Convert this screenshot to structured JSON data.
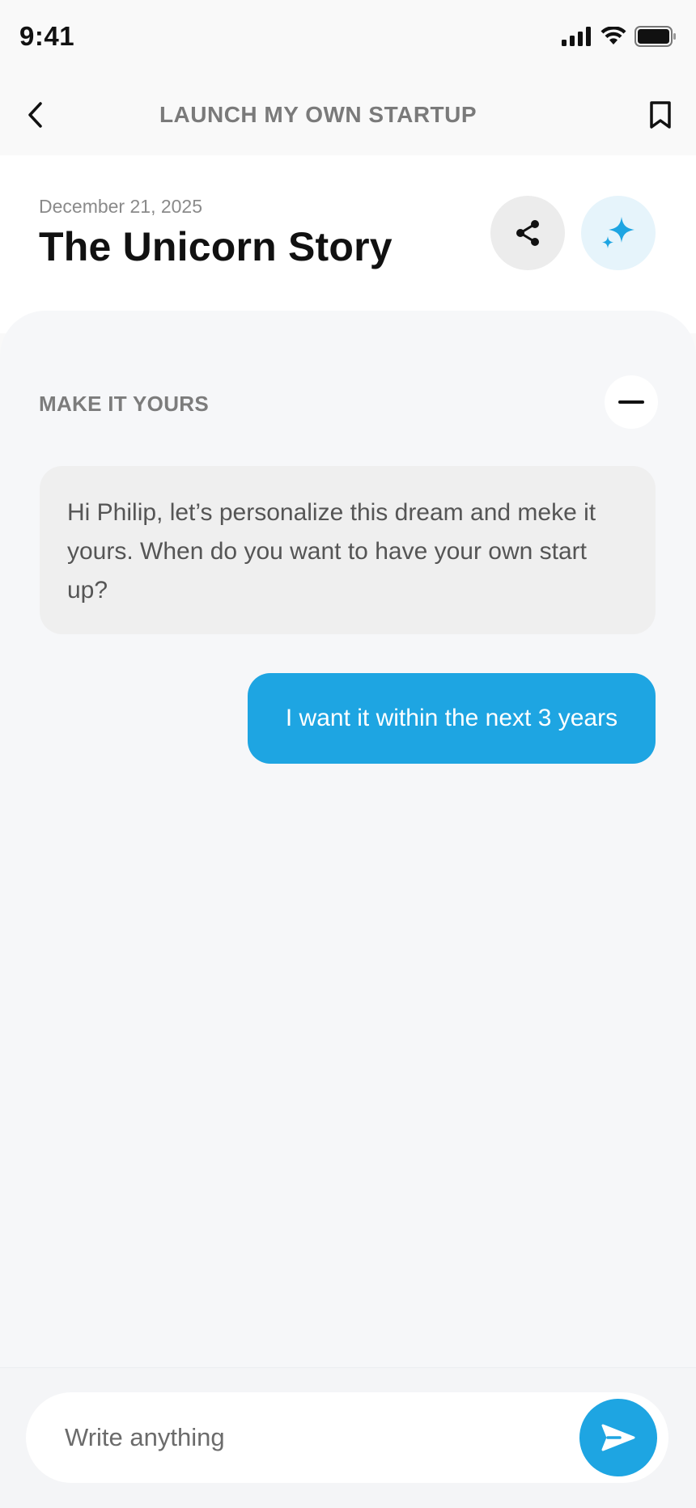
{
  "status_bar": {
    "time": "9:41"
  },
  "nav": {
    "title": "LAUNCH MY OWN STARTUP"
  },
  "header": {
    "date": "December 21, 2025",
    "title": "The Unicorn Story"
  },
  "section": {
    "label": "MAKE IT YOURS"
  },
  "messages": [
    {
      "role": "bot",
      "text": "Hi Philip, let’s personalize this dream and meke it yours. When do you want to have your own start up?"
    },
    {
      "role": "user",
      "text": "I want it within the next 3 years"
    }
  ],
  "composer": {
    "placeholder": "Write anything"
  },
  "colors": {
    "accent": "#1ea5e2",
    "accent_light": "#e6f4fb",
    "panel": "#f6f7f9"
  },
  "icons": [
    "back-chevron-icon",
    "bookmark-icon",
    "share-icon",
    "sparkle-icon",
    "minus-icon",
    "send-icon",
    "signal-icon",
    "wifi-icon",
    "battery-icon"
  ]
}
